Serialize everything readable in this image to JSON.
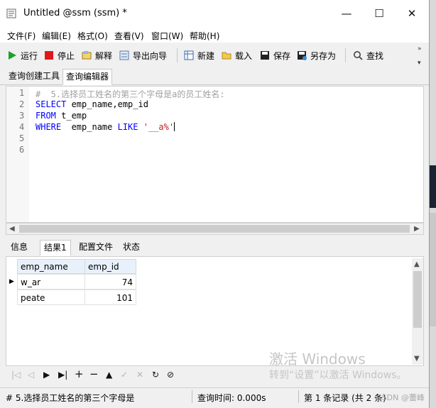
{
  "window": {
    "title": "Untitled @ssm (ssm) *",
    "minimize": "—",
    "maximize": "☐",
    "close": "✕"
  },
  "menu": [
    "文件(F)",
    "编辑(E)",
    "格式(O)",
    "查看(V)",
    "窗口(W)",
    "帮助(H)"
  ],
  "toolbar": {
    "run": "运行",
    "stop": "停止",
    "explain": "解释",
    "export_wizard": "导出向导",
    "new": "新建",
    "load": "载入",
    "save": "保存",
    "save_as": "另存为",
    "find": "查找"
  },
  "tabs": [
    "查询创建工具",
    "查询编辑器"
  ],
  "editor": {
    "line_numbers": [
      "1",
      "2",
      "3",
      "4",
      "5",
      "6"
    ],
    "line1_comment": "#  5.选择员工姓名的第三个字母是a的员工姓名:",
    "line2_kw": "SELECT",
    "line2_rest": " emp_name,emp_id",
    "line3_kw": "FROM",
    "line3_rest": " t_emp",
    "line4_kw": "WHERE",
    "line4_mid": "  emp_name ",
    "line4_kw2": "LIKE",
    "line4_str": " '__a%'"
  },
  "result_tabs": [
    "信息",
    "结果1",
    "配置文件",
    "状态"
  ],
  "grid": {
    "columns": [
      "emp_name",
      "emp_id"
    ],
    "rows": [
      {
        "emp_name": "w_ar",
        "emp_id": "74"
      },
      {
        "emp_name": "peate",
        "emp_id": "101"
      }
    ]
  },
  "watermark": {
    "line1": "激活 Windows",
    "line2": "转到“设置”以激活 Windows。"
  },
  "status": {
    "query_preview": "# 5.选择员工姓名的第三个字母是",
    "query_time": "查询时间: 0.000s",
    "record": "第 1 条记录 (共 2 条)",
    "credit": "CSDN @蕾峰"
  }
}
